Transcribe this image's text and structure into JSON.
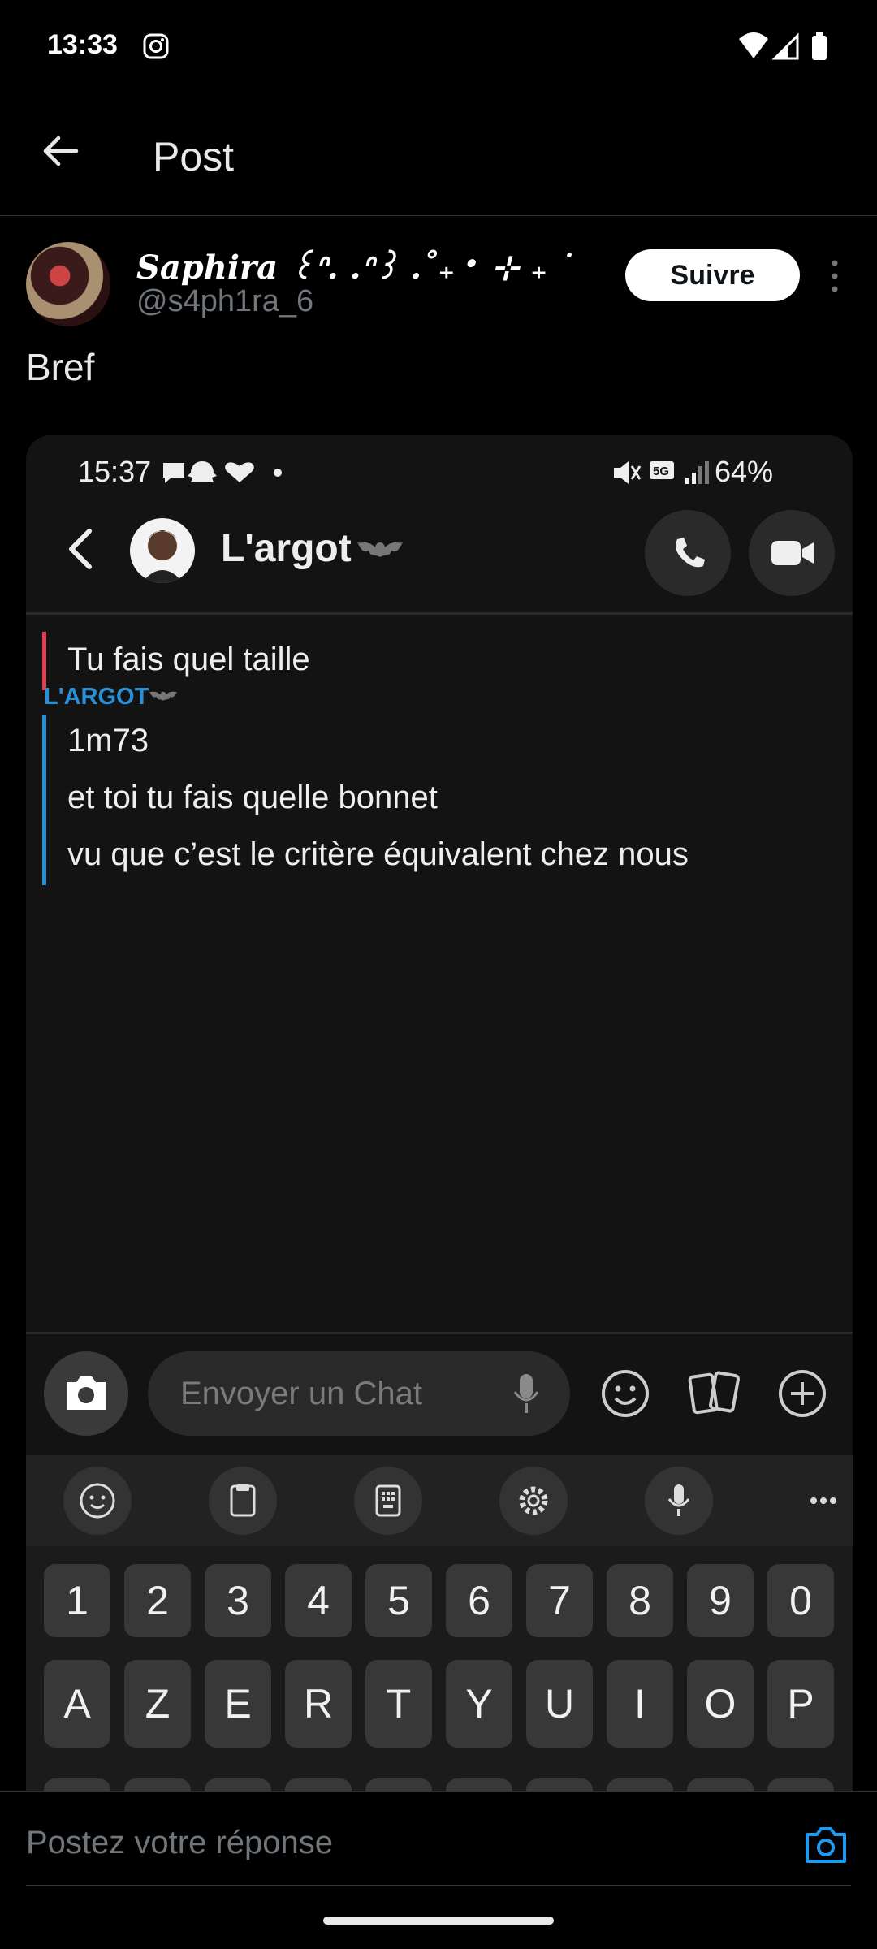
{
  "status_bar": {
    "time": "13:33",
    "icons": [
      "instagram-icon",
      "wifi-icon",
      "signal-icon",
      "battery-icon"
    ]
  },
  "header": {
    "title": "Post",
    "back_icon": "back-arrow-icon"
  },
  "post": {
    "author_name": "Saphira ꒰ᐢ. .ᐢ꒱ .˚₊‧ ⊹ ₊ ˙",
    "author_handle": "@s4ph1ra_6",
    "follow_label": "Suivre",
    "text": "Bref"
  },
  "embedded_screenshot": {
    "status_time": "15:37",
    "battery_percent": "64%",
    "contact_name": "L'argot",
    "quoted_message": "Tu fais quel taille",
    "sender_label": "L'ARGOT",
    "reply_lines": [
      "1m73",
      "et toi tu fais quelle bonnet",
      "vu que c’est le critère équivalent chez nous"
    ],
    "input_placeholder": "Envoyer un Chat",
    "keyboard": {
      "number_row": [
        "1",
        "2",
        "3",
        "4",
        "5",
        "6",
        "7",
        "8",
        "9",
        "0"
      ],
      "letter_row": [
        "A",
        "Z",
        "E",
        "R",
        "T",
        "Y",
        "U",
        "I",
        "O",
        "P"
      ],
      "toolbar_icons": [
        "emoji-icon",
        "clipboard-icon",
        "numpad-icon",
        "settings-icon",
        "mic-icon",
        "more-icon"
      ]
    }
  },
  "composer": {
    "placeholder": "Postez votre réponse"
  },
  "colors": {
    "background": "#000000",
    "accent_blue": "#1d9bf0",
    "quote_red": "#e04050",
    "reply_blue": "#2b8fd6"
  }
}
